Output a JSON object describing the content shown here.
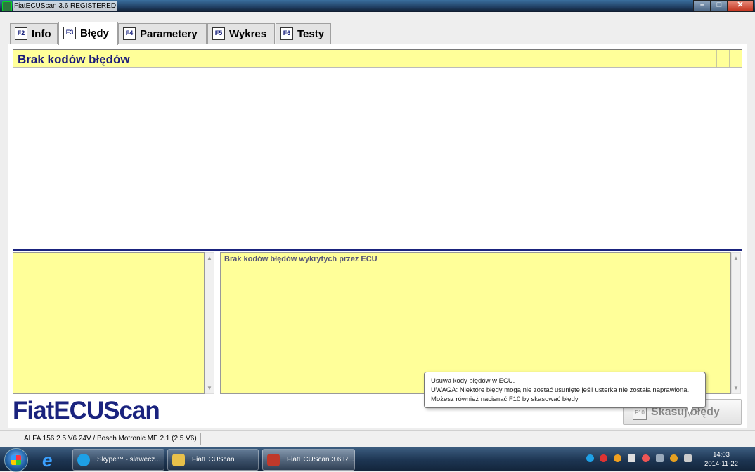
{
  "window": {
    "title": "FiatECUScan 3.6 REGISTERED",
    "controls": {
      "minimize": "–",
      "maximize": "□",
      "close": "✕"
    }
  },
  "tabs": [
    {
      "key": "F2",
      "label": "Info",
      "active": false
    },
    {
      "key": "F3",
      "label": "Błędy",
      "active": true
    },
    {
      "key": "F4",
      "label": "Parametery",
      "active": false
    },
    {
      "key": "F5",
      "label": "Wykres",
      "active": false
    },
    {
      "key": "F6",
      "label": "Testy",
      "active": false
    }
  ],
  "codes": {
    "header": "Brak kodów błędów",
    "rows": []
  },
  "details": {
    "left_text": "",
    "right_text": "Brak kodów błędów wykrytych przez ECU"
  },
  "logo": "FiatECUScan",
  "erase_button": {
    "key": "F10",
    "label": "Skasuj błędy"
  },
  "tooltip": {
    "line1": "Usuwa kody błędów w ECU.",
    "line2": "UWAGA: Niektóre błędy mogą nie zostać usunięte jeśli usterka nie została naprawiona.",
    "line3": "Możesz również nacisnąć F10 by skasować błędy"
  },
  "status": {
    "vehicle": "ALFA 156 2.5 V6 24V / Bosch Motronic ME 2.1 (2.5 V6)"
  },
  "taskbar": {
    "items": [
      {
        "label": "Skype™ - slawecz...",
        "icon": "skype-icon",
        "color": "#1ea0e6"
      },
      {
        "label": "FiatECUScan",
        "icon": "folder-icon",
        "color": "#e8c04a"
      },
      {
        "label": "FiatECUScan 3.6 R...",
        "icon": "fiatecuscan-app-icon",
        "color": "#c0392b"
      }
    ],
    "clock": {
      "time": "14:03",
      "date": "2014-11-22"
    }
  },
  "colors": {
    "accent": "#1a237e",
    "highlight_yellow": "#ffff99"
  }
}
